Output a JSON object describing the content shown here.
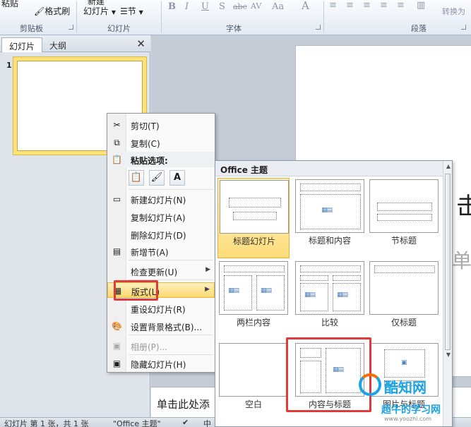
{
  "ribbon": {
    "paste_label": "粘贴",
    "format_painter": "格式刷",
    "new_slide_label": "新建",
    "slides_dropdown": "幻灯片",
    "section_dropdown": "节",
    "group_clipboard": "剪贴板",
    "group_slides": "幻灯片",
    "group_font": "字体",
    "group_paragraph": "段落",
    "font_buttons": [
      "B",
      "I",
      "U",
      "S",
      "abc",
      "AV",
      "Aa",
      "A"
    ],
    "convert_label": "转换为"
  },
  "slides_pane": {
    "tabs": [
      "幻灯片",
      "大纲"
    ],
    "close": "✕",
    "slide_number": "1"
  },
  "context_menu": {
    "items": [
      {
        "label": "剪切(T)",
        "icon": "scissors-icon"
      },
      {
        "label": "复制(C)",
        "icon": "copy-icon"
      },
      {
        "label": "粘贴选项:",
        "icon": "paste-icon"
      },
      {
        "label": "新建幻灯片(N)",
        "icon": "new-slide-icon"
      },
      {
        "label": "复制幻灯片(A)"
      },
      {
        "label": "删除幻灯片(D)"
      },
      {
        "label": "新增节(A)",
        "icon": "section-icon"
      },
      {
        "label": "检查更新(U)"
      },
      {
        "label": "版式(L)",
        "icon": "layout-icon"
      },
      {
        "label": "重设幻灯片(R)"
      },
      {
        "label": "设置背景格式(B)...",
        "icon": "background-icon"
      },
      {
        "label": "相册(P)...",
        "icon": "photo-album-icon"
      },
      {
        "label": "隐藏幻灯片(H)",
        "icon": "hide-slide-icon"
      }
    ]
  },
  "layout_gallery": {
    "header": "Office 主题",
    "layouts": [
      {
        "name": "标题幻灯片"
      },
      {
        "name": "标题和内容"
      },
      {
        "name": "节标题"
      },
      {
        "name": "两栏内容"
      },
      {
        "name": "比较"
      },
      {
        "name": "仅标题"
      },
      {
        "name": "空白"
      },
      {
        "name": "内容与标题"
      },
      {
        "name": "图片与标题"
      }
    ]
  },
  "slide_area": {
    "title_fragment": "击",
    "subtitle_fragment": "单",
    "notes_placeholder": "单击此处添"
  },
  "status_bar": {
    "slide_info": "幻灯片 第 1 张，共 1 张",
    "theme": "\"Office 主题\"",
    "lang": "中"
  },
  "watermark": {
    "title": "酷知网",
    "subtitle": "超牛的学习网",
    "url": "www.yoozhi.com"
  },
  "colors": {
    "highlight": "#fbd870",
    "annotation_red": "#e13a3a"
  }
}
